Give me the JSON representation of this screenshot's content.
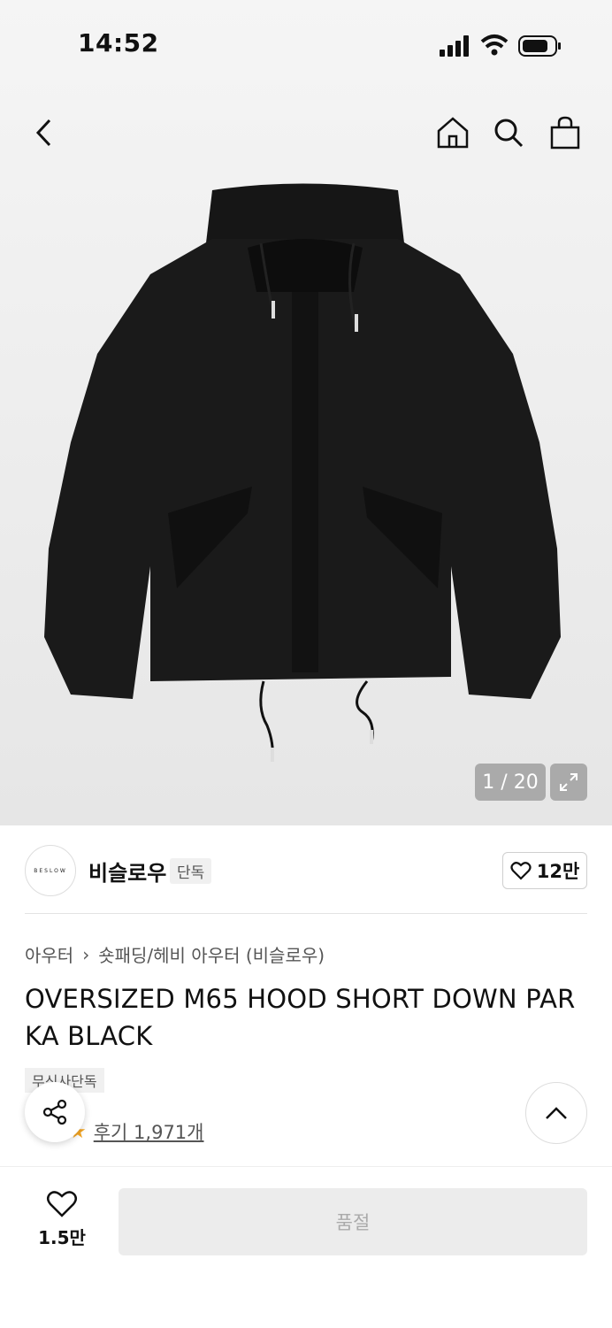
{
  "status_bar": {
    "time": "14:52"
  },
  "gallery": {
    "counter": "1 / 20"
  },
  "brand": {
    "logo_text": "BESLOW",
    "name": "비슬로우",
    "tag": "단독",
    "like_count": "12만"
  },
  "breadcrumb": {
    "category": "아우터",
    "separator": "›",
    "subcategory": "숏패딩/헤비 아우터 (비슬로우)"
  },
  "product": {
    "title": "OVERSIZED M65 HOOD SHORT DOWN PARKA BLACK",
    "badge": "무신사단독",
    "reviews_label": "후기 1,971개"
  },
  "bottom_bar": {
    "wish_count": "1.5만",
    "buy_label": "품절"
  },
  "colors": {
    "accent_star": "#f5a623",
    "disabled_button": "#ececec"
  }
}
